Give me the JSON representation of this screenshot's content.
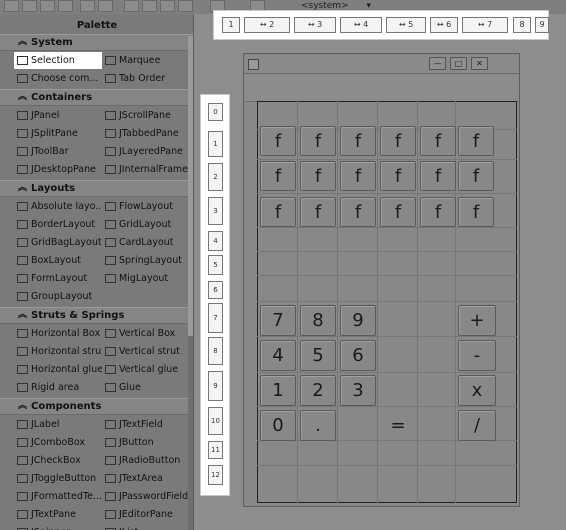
{
  "toolbar": {
    "system_combo": "<system>"
  },
  "palette": {
    "title": "Palette",
    "sections": [
      {
        "name": "System",
        "items": [
          "Selection",
          "Marquee",
          "Choose com...",
          "Tab Order"
        ]
      },
      {
        "name": "Containers",
        "items": [
          "JPanel",
          "JScrollPane",
          "JSplitPane",
          "JTabbedPane",
          "JToolBar",
          "JLayeredPane",
          "JDesktopPane",
          "JInternalFrame"
        ]
      },
      {
        "name": "Layouts",
        "items": [
          "Absolute layo...",
          "FlowLayout",
          "BorderLayout",
          "GridLayout",
          "GridBagLayout",
          "CardLayout",
          "BoxLayout",
          "SpringLayout",
          "FormLayout",
          "MigLayout",
          "GroupLayout"
        ]
      },
      {
        "name": "Struts & Springs",
        "items": [
          "Horizontal Box",
          "Vertical Box",
          "Horizontal strut",
          "Vertical strut",
          "Horizontal glue",
          "Vertical glue",
          "Rigid area",
          "Glue"
        ]
      },
      {
        "name": "Components",
        "items": [
          "JLabel",
          "JTextField",
          "JComboBox",
          "JButton",
          "JCheckBox",
          "JRadioButton",
          "JToggleButton",
          "JTextArea",
          "JFormattedTe...",
          "JPasswordField",
          "JTextPane",
          "JEditorPane",
          "JSpinner",
          "JList"
        ]
      }
    ]
  },
  "rulers": {
    "columns": [
      "1",
      "2",
      "3",
      "4",
      "5",
      "6",
      "7",
      "8",
      "9"
    ],
    "rows": [
      "0",
      "1",
      "2",
      "3",
      "4",
      "5",
      "6",
      "7",
      "8",
      "9",
      "10",
      "11",
      "12"
    ]
  },
  "calculator": {
    "function_buttons": [
      "f",
      "f",
      "f",
      "f",
      "f",
      "f",
      "f",
      "f",
      "f",
      "f",
      "f",
      "f",
      "f",
      "f",
      "f",
      "f",
      "f",
      "f"
    ],
    "digit_rows": [
      [
        "7",
        "8",
        "9"
      ],
      [
        "4",
        "5",
        "6"
      ],
      [
        "1",
        "2",
        "3"
      ],
      [
        "0",
        "."
      ]
    ],
    "equals": "=",
    "ops": [
      "+",
      "-",
      "x",
      "/"
    ]
  }
}
